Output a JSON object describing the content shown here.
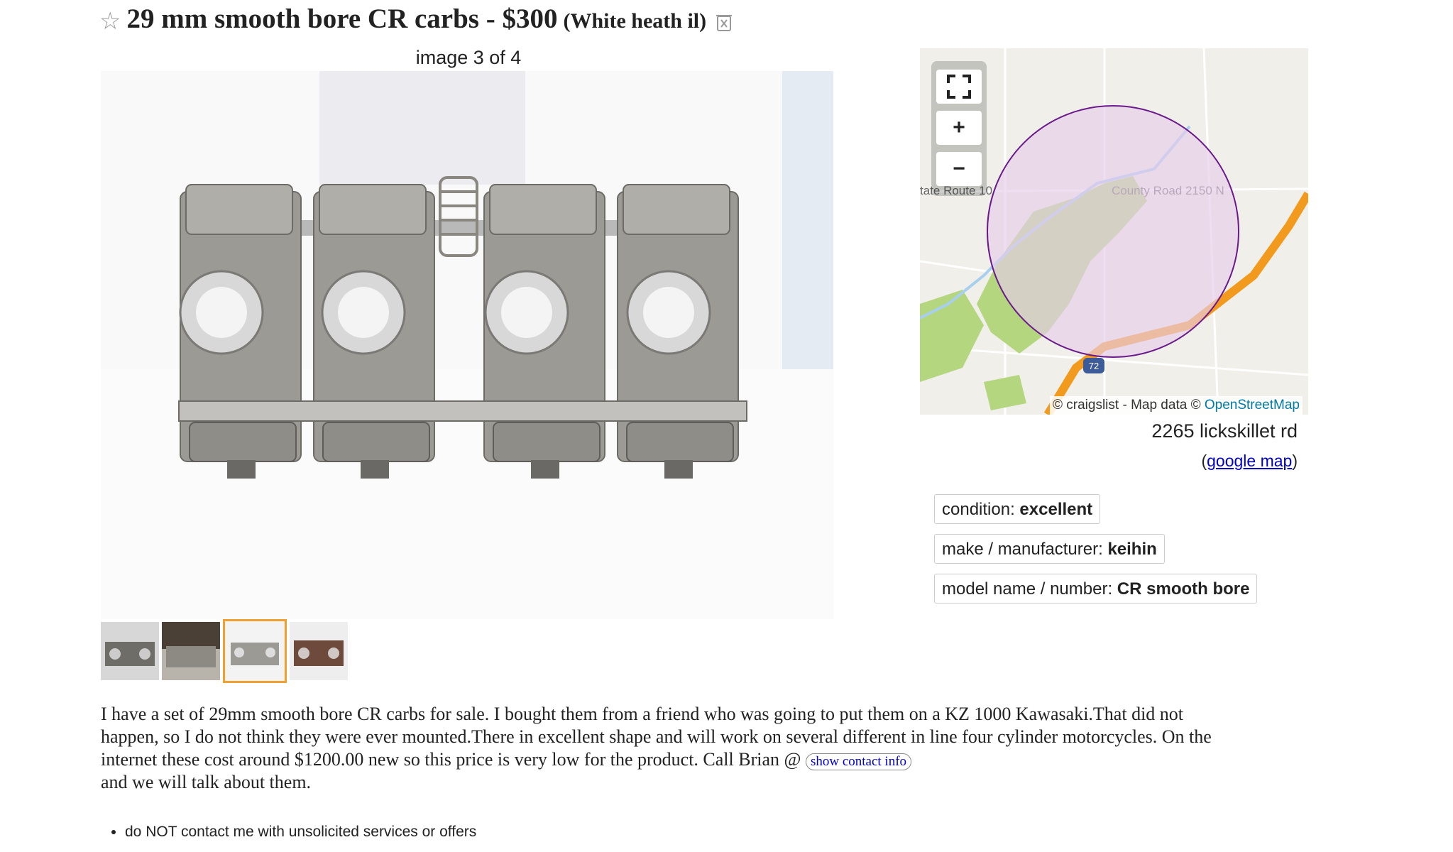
{
  "title": {
    "text": "29 mm smooth bore CR carbs - $300",
    "location": "(White heath il)"
  },
  "gallery": {
    "counter": "image 3 of 4",
    "thumbnail_count": 4,
    "selected_index": 3
  },
  "map": {
    "road_label_left": "tate Route 10",
    "road_label_right": "County Road 2150 N",
    "highway_shield": "72",
    "attribution_prefix": "© craigslist - Map data ©",
    "attribution_link": "OpenStreetMap",
    "zoom_in": "+",
    "zoom_out": "−",
    "address": "2265 lickskillet rd",
    "google_link_prefix": "(",
    "google_link": "google map",
    "google_link_suffix": ")"
  },
  "attributes": [
    {
      "label": "condition:",
      "value": "excellent"
    },
    {
      "label": "make / manufacturer:",
      "value": "keihin"
    },
    {
      "label": "model name / number:",
      "value": "CR smooth bore"
    }
  ],
  "body": {
    "line1": "I have a set of 29mm smooth bore CR carbs for sale. I bought them from a friend who was going to put them on a KZ 1000 Kawasaki.That did not",
    "line2": "happen, so I do not think they were ever mounted.There in excellent shape and will work on several different in line four cylinder motorcycles. On the",
    "line3": "internet these cost around $1200.00 new so this price is very low for the product. Call Brian @ ",
    "contact_button": "show contact info",
    "line4": "and we will talk about them."
  },
  "notices": [
    "do NOT contact me with unsolicited services or offers"
  ],
  "colors": {
    "map_circle_stroke": "#6a1a8a",
    "map_circle_fill": "#e6cdea",
    "highway": "#f29a1d",
    "park": "#b4d67e",
    "selected_thumb_border": "#f0a030",
    "link": "#0000cc"
  }
}
